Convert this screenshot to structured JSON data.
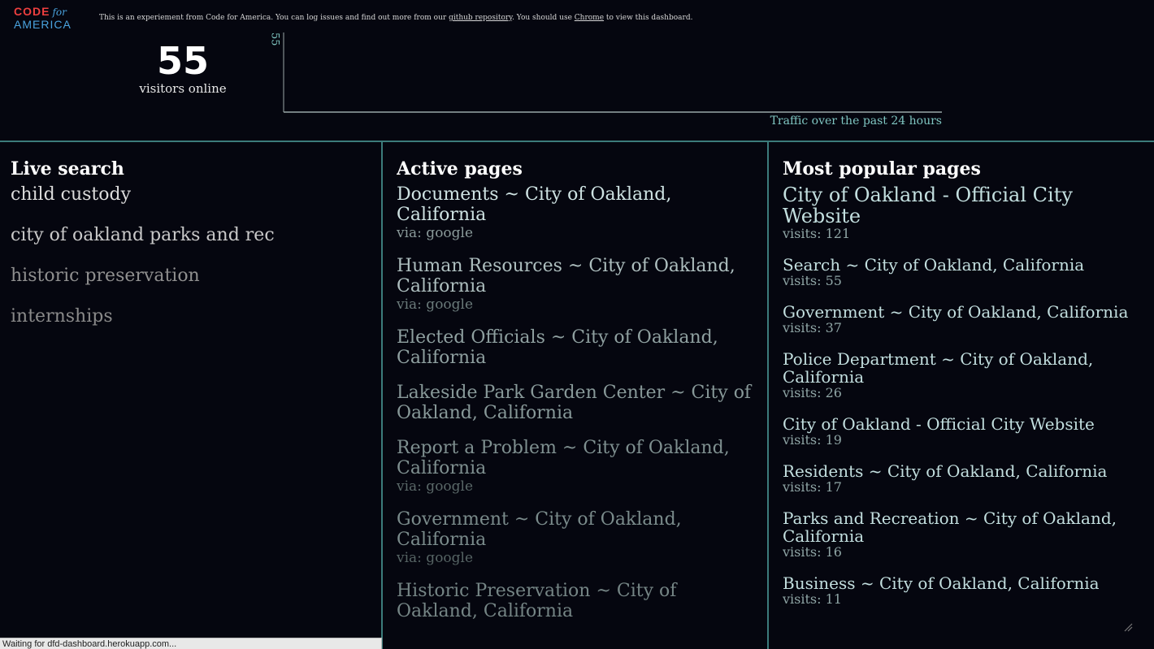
{
  "logo": {
    "line1": "CODE",
    "for": "for",
    "line2": "AMERICA"
  },
  "notice": {
    "prefix": "This is an experiement from Code for America. You can log issues and find out more from our ",
    "repo_link": "github repository",
    "middle": ". You should use ",
    "chrome_link": "Chrome",
    "suffix": " to view this dashboard."
  },
  "visitors": {
    "count": "55",
    "label": "visitors online"
  },
  "chart_data": {
    "type": "line",
    "y_max_label": "55",
    "title": "Traffic over the past 24 hours",
    "x": [],
    "series": []
  },
  "live_search": {
    "heading": "Live search",
    "items": [
      {
        "text": "child custody",
        "color": "#dcdcdc"
      },
      {
        "text": "city of oakland parks and rec",
        "color": "#c9c9c9"
      },
      {
        "text": "historic preservation",
        "color": "#8f8f8f"
      },
      {
        "text": "internships",
        "color": "#8a8a8a"
      }
    ]
  },
  "active_pages": {
    "heading": "Active pages",
    "items": [
      {
        "title": "Documents ~ City of Oakland, California",
        "via": "via: google",
        "color": "#cfe3e3",
        "via_color": "#8a9a9a"
      },
      {
        "title": "Human Resources ~ City of Oakland, California",
        "via": "via: google",
        "color": "#aebfbf",
        "via_color": "#6a7a7a"
      },
      {
        "title": "Elected Officials ~ City of Oakland, California",
        "via": "",
        "color": "#8fa0a0",
        "via_color": "#5f6d6d"
      },
      {
        "title": "Lakeside Park Garden Center ~ City of Oakland, California",
        "via": "",
        "color": "#889999",
        "via_color": "#5f6d6d"
      },
      {
        "title": "Report a Problem ~ City of Oakland, California",
        "via": "via: google",
        "color": "#7f9090",
        "via_color": "#5a6868"
      },
      {
        "title": "Government ~ City of Oakland, California",
        "via": "via: google",
        "color": "#7a8b8b",
        "via_color": "#566464"
      },
      {
        "title": "Historic Preservation ~ City of Oakland, California",
        "via": "",
        "color": "#758585",
        "via_color": "#526060"
      }
    ]
  },
  "popular_pages": {
    "heading": "Most popular pages",
    "items": [
      {
        "title": "City of Oakland - Official City Website",
        "visits": "visits: 121",
        "big": true
      },
      {
        "title": "Search ~ City of Oakland, California",
        "visits": "visits: 55",
        "big": false
      },
      {
        "title": "Government ~ City of Oakland, California",
        "visits": "visits: 37",
        "big": false
      },
      {
        "title": "Police Department ~ City of Oakland, California",
        "visits": "visits: 26",
        "big": false
      },
      {
        "title": "City of Oakland - Official City Website",
        "visits": "visits: 19",
        "big": false
      },
      {
        "title": "Residents ~ City of Oakland, California",
        "visits": "visits: 17",
        "big": false
      },
      {
        "title": "Parks and Recreation ~ City of Oakland, California",
        "visits": "visits: 16",
        "big": false
      },
      {
        "title": "Business ~ City of Oakland, California",
        "visits": "visits: 11",
        "big": false
      }
    ]
  },
  "status_bar": {
    "text": "Waiting for dfd-dashboard.herokuapp.com..."
  }
}
